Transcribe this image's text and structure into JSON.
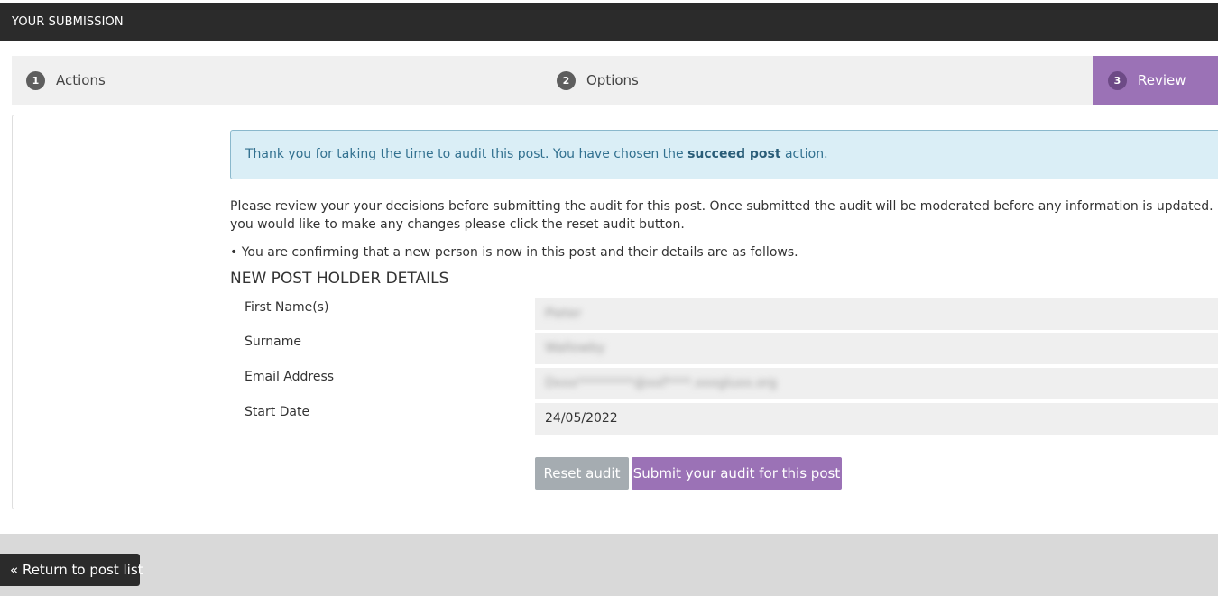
{
  "header": {
    "title": "YOUR SUBMISSION"
  },
  "steps": [
    {
      "number": "1",
      "label": "Actions"
    },
    {
      "number": "2",
      "label": "Options"
    },
    {
      "number": "3",
      "label": "Review",
      "active": true
    }
  ],
  "alert": {
    "text_before": "Thank you for taking the time to audit this post. You have chosen the ",
    "bold": "succeed post",
    "text_after": " action."
  },
  "intro": "Please review your your decisions before submitting the audit for this post. Once submitted the audit will be moderated before any information is updated. If you would like to make any changes please click the reset audit button.",
  "bullet": "• You are confirming that a new person is now in this post and their details are as follows.",
  "section_title": "NEW POST HOLDER DETAILS",
  "details": {
    "first_name": {
      "label": "First Name(s)",
      "value": "Pieter"
    },
    "surname": {
      "label": "Surname",
      "value": "Wallowby"
    },
    "email": {
      "label": "Email Address",
      "value": "Dxxx*********@xxf****.xxxgluxx.org"
    },
    "start_date": {
      "label": "Start Date",
      "value": "24/05/2022"
    }
  },
  "buttons": {
    "reset": "Reset audit",
    "submit": "Submit your audit for this post",
    "return": "« Return to post list"
  },
  "colors": {
    "accent": "#9b72b6",
    "header_bg": "#2b2b2b",
    "alert_bg": "#daeef6"
  }
}
